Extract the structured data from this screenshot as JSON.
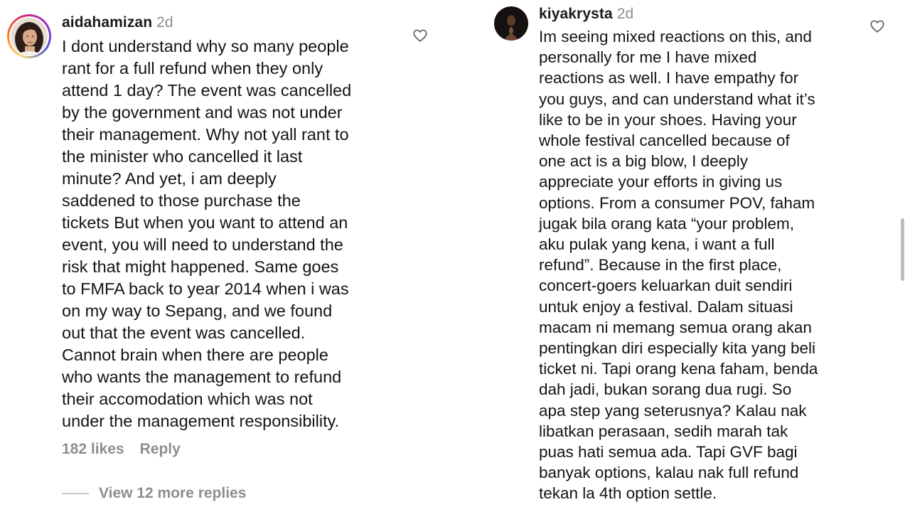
{
  "comments": [
    {
      "username": "aidahamizan",
      "time": "2d",
      "text": "I dont understand why so many people\nrant for a full refund when they only\nattend 1 day? The event was cancelled\nby the government and was not under\ntheir management. Why not yall rant to\nthe minister who cancelled it last\nminute? And yet, i am deeply\nsaddened to those purchase the\ntickets But when you want to attend an\nevent, you will need to understand the\nrisk that might happened. Same goes\nto FMFA back to year 2014 when i was\non my way to Sepang, and we found\nout that the event was cancelled.\nCannot brain when there are people\nwho wants the management to refund\ntheir accomodation which was not\nunder the management responsibility.",
      "likes": "182 likes",
      "reply_label": "Reply",
      "view_replies": "View 12 more replies"
    },
    {
      "username": "kiyakrysta",
      "time": "2d",
      "text": "Im seeing mixed reactions on this, and\npersonally for me I have mixed\nreactions as well. I have empathy for\nyou guys, and can understand what it’s\nlike to be in your shoes. Having your\nwhole festival cancelled because of\none act is a big blow, I deeply\nappreciate your efforts in giving us\noptions. From a consumer POV, faham\njugak bila orang kata “your problem,\naku pulak yang kena, i want a full\nrefund”. Because in the first place,\nconcert-goers keluarkan duit sendiri\nuntuk enjoy a festival. Dalam situasi\nmacam ni memang semua orang akan\npentingkan diri especially kita yang beli\nticket ni. Tapi orang kena faham, benda\ndah jadi, bukan sorang dua rugi. So\napa step yang seterusnya? Kalau nak\nlibatkan perasaan, sedih marah tak\npuas hati semua ada. Tapi GVF bagi\nbanyak options, kalau nak full refund\ntekan la 4th option settle."
    }
  ],
  "icons": {
    "like": "heart-icon"
  },
  "colors": {
    "text": "#141414",
    "muted": "#8e8e8e",
    "story_ring": [
      "#feda75",
      "#fa7e1e",
      "#d62976",
      "#962fbf",
      "#4f5bd5"
    ]
  }
}
